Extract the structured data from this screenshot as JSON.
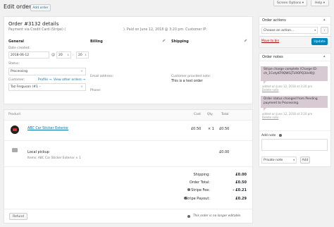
{
  "header": {
    "title": "Edit order",
    "add_order": "Add order",
    "screen_options": "Screen Options",
    "help": "Help"
  },
  "order": {
    "title": "Order #3132 details",
    "payment_line": "Payment via Credit Card (Stripe) (",
    "paid_line": "). Paid on June 12, 2018 @ 3:20 pm. Customer IP:",
    "general_heading": "General",
    "date_created_label": "Date created:",
    "date_value": "2018-06-12",
    "hour_value": "20",
    "minute_value": "20",
    "at_symbol": "@",
    "colon": ":",
    "status_label": "Status:",
    "status_value": "Processing",
    "customer_label": "Customer:",
    "profile_link": "Profile →",
    "other_orders_link": "View other orders →",
    "customer_value": "Taz Ferguson (#1 –",
    "billing_heading": "Billing",
    "shipping_heading": "Shipping",
    "email_label": "Email address:",
    "phone_label": "Phone:",
    "customer_note_label": "Customer provided note:",
    "customer_note_value": "This is a test order"
  },
  "items": {
    "col_product": "Product",
    "col_cost": "Cost",
    "col_qty": "Qty",
    "col_total": "Total",
    "rows": [
      {
        "name": "ABC Car Sticker Exterior",
        "cost": "£0.50",
        "qty": "× 1",
        "total": "£0.50"
      }
    ],
    "shipping_row": {
      "name": "Local pickup",
      "items_text": "Items: ABC Car Sticker Exterior × 1",
      "total": "£0.00"
    },
    "totals": [
      {
        "label": "Shipping:",
        "value": "£0.00"
      },
      {
        "label": "Order Total:",
        "value": "£0.50"
      },
      {
        "label": "Stripe Fee:",
        "value": "- £0.21"
      },
      {
        "label": "Stripe Payout:",
        "value": "£0.29"
      }
    ],
    "refund_button": "Refund",
    "not_editable": "This order is no longer editable."
  },
  "order_actions": {
    "title": "Order actions",
    "select_value": "Choose an action...",
    "move_to_bin": "Move to bin",
    "update_button": "Update"
  },
  "order_notes": {
    "title": "Order notes",
    "notes": [
      {
        "text": "Stripe charge complete (Charge ID: ch_1CotyKF9QWGjTL9OPQ3UcKtJ)",
        "meta": "added on June 12, 2018 at 3:20 pm",
        "delete": "Delete note"
      },
      {
        "text": "Order status changed from Pending payment to Processing.",
        "meta": "added on June 12, 2018 at 3:20 pm",
        "delete": "Delete note"
      }
    ],
    "add_note_label": "Add note",
    "note_type_value": "Private note",
    "add_button": "Add"
  },
  "colors": {
    "accent": "#0073aa",
    "note_bg": "#d7cad2",
    "update_btn": "#0085ba"
  }
}
